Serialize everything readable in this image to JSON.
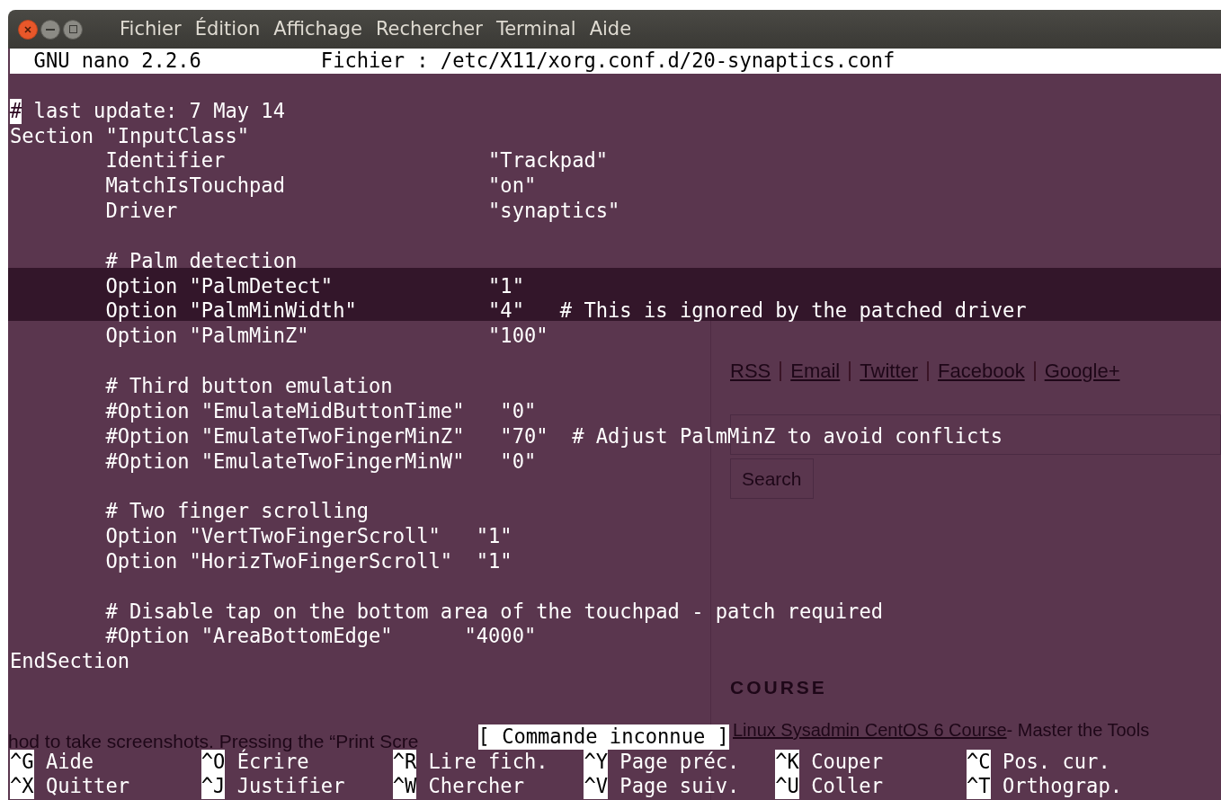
{
  "menu_bar": {
    "items": [
      {
        "label": "Fichier"
      },
      {
        "label": "Édition"
      },
      {
        "label": "Affichage"
      },
      {
        "label": "Rechercher"
      },
      {
        "label": "Terminal"
      },
      {
        "label": "Aide"
      }
    ]
  },
  "nano_header": {
    "program": "GNU nano 2.2.6",
    "file": "Fichier : /etc/X11/xorg.conf.d/20-synaptics.conf"
  },
  "lines": [
    {
      "kind": "blank"
    },
    {
      "kind": "code",
      "indent": false,
      "cursor": true,
      "text": "# last update: 7 May 14"
    },
    {
      "kind": "code",
      "indent": false,
      "cursor": false,
      "text": "Section \"InputClass\""
    },
    {
      "kind": "code",
      "indent": true,
      "cursor": false,
      "text": "Identifier                      \"Trackpad\""
    },
    {
      "kind": "code",
      "indent": true,
      "cursor": false,
      "text": "MatchIsTouchpad                 \"on\""
    },
    {
      "kind": "code",
      "indent": true,
      "cursor": false,
      "text": "Driver                          \"synaptics\""
    },
    {
      "kind": "blank"
    },
    {
      "kind": "code",
      "indent": true,
      "cursor": false,
      "text": "# Palm detection"
    },
    {
      "kind": "code",
      "indent": true,
      "cursor": false,
      "text": "Option \"PalmDetect\"             \"1\""
    },
    {
      "kind": "code",
      "indent": true,
      "cursor": false,
      "text": "Option \"PalmMinWidth\"           \"4\"   # This is ignored by the patched driver"
    },
    {
      "kind": "code",
      "indent": true,
      "cursor": false,
      "text": "Option \"PalmMinZ\"               \"100\""
    },
    {
      "kind": "blank"
    },
    {
      "kind": "code",
      "indent": true,
      "cursor": false,
      "text": "# Third button emulation"
    },
    {
      "kind": "code",
      "indent": true,
      "cursor": false,
      "text": "#Option \"EmulateMidButtonTime\"   \"0\""
    },
    {
      "kind": "code",
      "indent": true,
      "cursor": false,
      "text": "#Option \"EmulateTwoFingerMinZ\"   \"70\"  # Adjust PalmMinZ to avoid conflicts"
    },
    {
      "kind": "code",
      "indent": true,
      "cursor": false,
      "text": "#Option \"EmulateTwoFingerMinW\"   \"0\""
    },
    {
      "kind": "blank"
    },
    {
      "kind": "code",
      "indent": true,
      "cursor": false,
      "text": "# Two finger scrolling"
    },
    {
      "kind": "code",
      "indent": true,
      "cursor": false,
      "text": "Option \"VertTwoFingerScroll\"   \"1\""
    },
    {
      "kind": "code",
      "indent": true,
      "cursor": false,
      "text": "Option \"HorizTwoFingerScroll\"  \"1\""
    },
    {
      "kind": "blank"
    },
    {
      "kind": "code",
      "indent": true,
      "cursor": false,
      "text": "# Disable tap on the bottom area of the touchpad - patch required"
    },
    {
      "kind": "code",
      "indent": true,
      "cursor": false,
      "text": "#Option \"AreaBottomEdge\"      \"4000\""
    },
    {
      "kind": "code",
      "indent": false,
      "cursor": false,
      "text": "EndSection"
    }
  ],
  "status_message": "[ Commande inconnue ]",
  "shortcuts": [
    {
      "key": "^G",
      "label": "Aide"
    },
    {
      "key": "^O",
      "label": "Écrire"
    },
    {
      "key": "^R",
      "label": "Lire fich."
    },
    {
      "key": "^Y",
      "label": "Page préc."
    },
    {
      "key": "^K",
      "label": "Couper"
    },
    {
      "key": "^C",
      "label": "Pos. cur."
    },
    {
      "key": "^X",
      "label": "Quitter"
    },
    {
      "key": "^J",
      "label": "Justifier"
    },
    {
      "key": "^W",
      "label": "Chercher"
    },
    {
      "key": "^V",
      "label": "Page suiv."
    },
    {
      "key": "^U",
      "label": "Coller"
    },
    {
      "key": "^T",
      "label": "Orthograp."
    }
  ],
  "background_page": {
    "social_links": [
      {
        "label": "RSS"
      },
      {
        "label": "Email"
      },
      {
        "label": "Twitter"
      },
      {
        "label": "Facebook"
      },
      {
        "label": "Google+"
      }
    ],
    "search_button": "Search",
    "course_heading": "COURSE",
    "course_link": "Linux Sysadmin CentOS 6 Course",
    "course_text": " - Master the Tools",
    "article_text": "hod to take screenshots. Pressing the “Print Scre"
  }
}
